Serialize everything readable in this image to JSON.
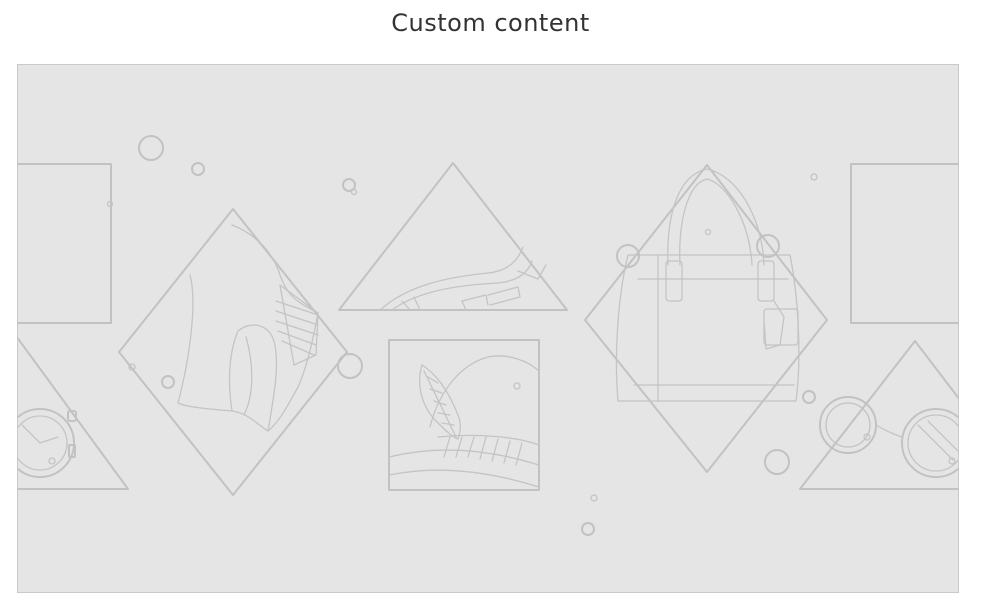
{
  "page": {
    "title": "Custom content"
  },
  "illustration": {
    "background_color": "#e5e5e5",
    "line_color": "#c2c2c2",
    "icons": [
      "boot-icon",
      "jeans-icon",
      "hat-icon",
      "handbag-icon",
      "watch-icon",
      "eyeglasses-icon"
    ]
  }
}
